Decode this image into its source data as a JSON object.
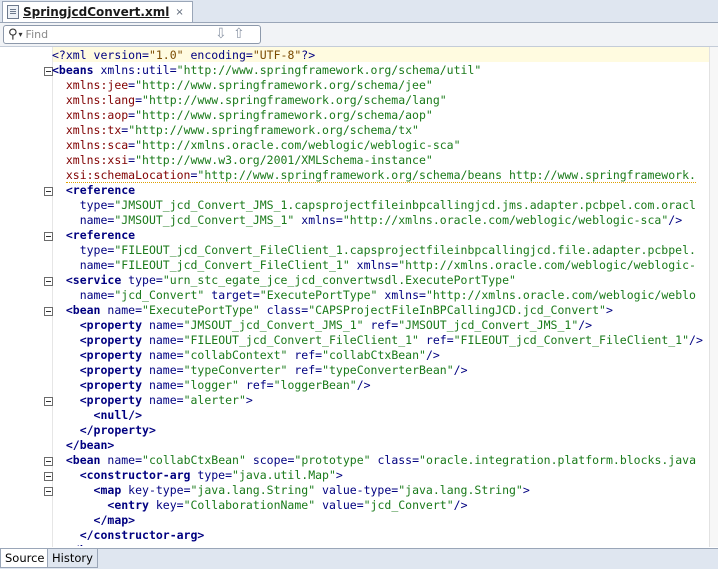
{
  "tab": {
    "title": "SpringjcdConvert.xml",
    "close": "×"
  },
  "find": {
    "placeholder": "Find"
  },
  "lines": [
    [
      [
        "pi",
        "<?xml "
      ],
      [
        "attr",
        "version"
      ],
      [
        "punc",
        "="
      ],
      [
        "pival",
        "\"1.0\""
      ],
      [
        "attr",
        " encoding"
      ],
      [
        "punc",
        "="
      ],
      [
        "pival",
        "\"UTF-8\""
      ],
      [
        "pi",
        "?>"
      ]
    ],
    [
      [
        "tag",
        "<beans"
      ],
      [
        "attr",
        " xmlns:util"
      ],
      [
        "punc",
        "="
      ],
      [
        "val",
        "\"http://www.springframework.org/schema/util\""
      ]
    ],
    [
      [
        "plain",
        "  "
      ],
      [
        "ns",
        "xmlns:jee"
      ],
      [
        "punc",
        "="
      ],
      [
        "val",
        "\"http://www.springframework.org/schema/jee\""
      ]
    ],
    [
      [
        "plain",
        "  "
      ],
      [
        "ns",
        "xmlns:lang"
      ],
      [
        "punc",
        "="
      ],
      [
        "val",
        "\"http://www.springframework.org/schema/lang\""
      ]
    ],
    [
      [
        "plain",
        "  "
      ],
      [
        "ns",
        "xmlns:aop"
      ],
      [
        "punc",
        "="
      ],
      [
        "val",
        "\"http://www.springframework.org/schema/aop\""
      ]
    ],
    [
      [
        "plain",
        "  "
      ],
      [
        "ns",
        "xmlns:tx"
      ],
      [
        "punc",
        "="
      ],
      [
        "val",
        "\"http://www.springframework.org/schema/tx\""
      ]
    ],
    [
      [
        "plain",
        "  "
      ],
      [
        "ns",
        "xmlns:sca"
      ],
      [
        "punc",
        "="
      ],
      [
        "val",
        "\"http://xmlns.oracle.com/weblogic/weblogic-sca\""
      ]
    ],
    [
      [
        "plain",
        "  "
      ],
      [
        "ns",
        "xmlns:xsi"
      ],
      [
        "punc",
        "="
      ],
      [
        "val",
        "\"http://www.w3.org/2001/XMLSchema-instance\""
      ]
    ],
    [
      [
        "plain",
        "  "
      ],
      [
        "ns",
        "xsi:schemaLocation"
      ],
      [
        "punc",
        "="
      ],
      [
        "val",
        "\"http://www.springframework.org/schema/beans http://www.springframework."
      ]
    ],
    [
      [
        "plain",
        "  "
      ],
      [
        "tag",
        "<reference"
      ]
    ],
    [
      [
        "plain",
        "    "
      ],
      [
        "attr",
        "type"
      ],
      [
        "punc",
        "="
      ],
      [
        "val",
        "\"JMSOUT_jcd_Convert_JMS_1.capsprojectfileinbpcallingjcd.jms.adapter.pcbpel.com.oracl"
      ]
    ],
    [
      [
        "plain",
        "    "
      ],
      [
        "attr",
        "name"
      ],
      [
        "punc",
        "="
      ],
      [
        "val",
        "\"JMSOUT_jcd_Convert_JMS_1\""
      ],
      [
        "attr",
        " xmlns"
      ],
      [
        "punc",
        "="
      ],
      [
        "val",
        "\"http://xmlns.oracle.com/weblogic/weblogic-sca\""
      ],
      [
        "punc",
        "/>"
      ]
    ],
    [
      [
        "plain",
        "  "
      ],
      [
        "tag",
        "<reference"
      ]
    ],
    [
      [
        "plain",
        "    "
      ],
      [
        "attr",
        "type"
      ],
      [
        "punc",
        "="
      ],
      [
        "val",
        "\"FILEOUT_jcd_Convert_FileClient_1.capsprojectfileinbpcallingjcd.file.adapter.pcbpel."
      ]
    ],
    [
      [
        "plain",
        "    "
      ],
      [
        "attr",
        "name"
      ],
      [
        "punc",
        "="
      ],
      [
        "val",
        "\"FILEOUT_jcd_Convert_FileClient_1\""
      ],
      [
        "attr",
        " xmlns"
      ],
      [
        "punc",
        "="
      ],
      [
        "val",
        "\"http://xmlns.oracle.com/weblogic/weblogic-"
      ]
    ],
    [
      [
        "plain",
        "  "
      ],
      [
        "tag",
        "<service"
      ],
      [
        "attr",
        " type"
      ],
      [
        "punc",
        "="
      ],
      [
        "val",
        "\"urn_stc_egate_jce_jcd_convertwsdl.ExecutePortType\""
      ]
    ],
    [
      [
        "plain",
        "    "
      ],
      [
        "attr",
        "name"
      ],
      [
        "punc",
        "="
      ],
      [
        "val",
        "\"jcd_Convert\""
      ],
      [
        "attr",
        " target"
      ],
      [
        "punc",
        "="
      ],
      [
        "val",
        "\"ExecutePortType\""
      ],
      [
        "attr",
        " xmlns"
      ],
      [
        "punc",
        "="
      ],
      [
        "val",
        "\"http://xmlns.oracle.com/weblogic/weblo"
      ]
    ],
    [
      [
        "plain",
        "  "
      ],
      [
        "tag",
        "<bean"
      ],
      [
        "attr",
        " name"
      ],
      [
        "punc",
        "="
      ],
      [
        "val",
        "\"ExecutePortType\""
      ],
      [
        "attr",
        " class"
      ],
      [
        "punc",
        "="
      ],
      [
        "val",
        "\"CAPSProjectFileInBPCallingJCD.jcd_Convert\""
      ],
      [
        "punc",
        ">"
      ]
    ],
    [
      [
        "plain",
        "    "
      ],
      [
        "tag",
        "<property"
      ],
      [
        "attr",
        " name"
      ],
      [
        "punc",
        "="
      ],
      [
        "val",
        "\"JMSOUT_jcd_Convert_JMS_1\""
      ],
      [
        "attr",
        " ref"
      ],
      [
        "punc",
        "="
      ],
      [
        "val",
        "\"JMSOUT_jcd_Convert_JMS_1\""
      ],
      [
        "punc",
        "/>"
      ]
    ],
    [
      [
        "plain",
        "    "
      ],
      [
        "tag",
        "<property"
      ],
      [
        "attr",
        " name"
      ],
      [
        "punc",
        "="
      ],
      [
        "val",
        "\"FILEOUT_jcd_Convert_FileClient_1\""
      ],
      [
        "attr",
        " ref"
      ],
      [
        "punc",
        "="
      ],
      [
        "val",
        "\"FILEOUT_jcd_Convert_FileClient_1\""
      ],
      [
        "punc",
        "/>"
      ]
    ],
    [
      [
        "plain",
        "    "
      ],
      [
        "tag",
        "<property"
      ],
      [
        "attr",
        " name"
      ],
      [
        "punc",
        "="
      ],
      [
        "val",
        "\"collabContext\""
      ],
      [
        "attr",
        " ref"
      ],
      [
        "punc",
        "="
      ],
      [
        "val",
        "\"collabCtxBean\""
      ],
      [
        "punc",
        "/>"
      ]
    ],
    [
      [
        "plain",
        "    "
      ],
      [
        "tag",
        "<property"
      ],
      [
        "attr",
        " name"
      ],
      [
        "punc",
        "="
      ],
      [
        "val",
        "\"typeConverter\""
      ],
      [
        "attr",
        " ref"
      ],
      [
        "punc",
        "="
      ],
      [
        "val",
        "\"typeConverterBean\""
      ],
      [
        "punc",
        "/>"
      ]
    ],
    [
      [
        "plain",
        "    "
      ],
      [
        "tag",
        "<property"
      ],
      [
        "attr",
        " name"
      ],
      [
        "punc",
        "="
      ],
      [
        "val",
        "\"logger\""
      ],
      [
        "attr",
        " ref"
      ],
      [
        "punc",
        "="
      ],
      [
        "val",
        "\"loggerBean\""
      ],
      [
        "punc",
        "/>"
      ]
    ],
    [
      [
        "plain",
        "    "
      ],
      [
        "tag",
        "<property"
      ],
      [
        "attr",
        " name"
      ],
      [
        "punc",
        "="
      ],
      [
        "val",
        "\"alerter\""
      ],
      [
        "punc",
        ">"
      ]
    ],
    [
      [
        "plain",
        "      "
      ],
      [
        "tag",
        "<null/>"
      ]
    ],
    [
      [
        "plain",
        "    "
      ],
      [
        "tag",
        "</property>"
      ]
    ],
    [
      [
        "plain",
        "  "
      ],
      [
        "tag",
        "</bean>"
      ]
    ],
    [
      [
        "plain",
        "  "
      ],
      [
        "tag",
        "<bean"
      ],
      [
        "attr",
        " name"
      ],
      [
        "punc",
        "="
      ],
      [
        "val",
        "\"collabCtxBean\""
      ],
      [
        "attr",
        " scope"
      ],
      [
        "punc",
        "="
      ],
      [
        "val",
        "\"prototype\""
      ],
      [
        "attr",
        " class"
      ],
      [
        "punc",
        "="
      ],
      [
        "val",
        "\"oracle.integration.platform.blocks.java"
      ]
    ],
    [
      [
        "plain",
        "    "
      ],
      [
        "tag",
        "<constructor-arg"
      ],
      [
        "attr",
        " type"
      ],
      [
        "punc",
        "="
      ],
      [
        "val",
        "\"java.util.Map\""
      ],
      [
        "punc",
        ">"
      ]
    ],
    [
      [
        "plain",
        "      "
      ],
      [
        "tag",
        "<map"
      ],
      [
        "attr",
        " key-type"
      ],
      [
        "punc",
        "="
      ],
      [
        "val",
        "\"java.lang.String\""
      ],
      [
        "attr",
        " value-type"
      ],
      [
        "punc",
        "="
      ],
      [
        "val",
        "\"java.lang.String\""
      ],
      [
        "punc",
        ">"
      ]
    ],
    [
      [
        "plain",
        "        "
      ],
      [
        "tag",
        "<entry"
      ],
      [
        "attr",
        " key"
      ],
      [
        "punc",
        "="
      ],
      [
        "val",
        "\"CollaborationName\""
      ],
      [
        "attr",
        " value"
      ],
      [
        "punc",
        "="
      ],
      [
        "val",
        "\"jcd_Convert\""
      ],
      [
        "punc",
        "/>"
      ]
    ],
    [
      [
        "plain",
        "      "
      ],
      [
        "tag",
        "</map>"
      ]
    ],
    [
      [
        "plain",
        "    "
      ],
      [
        "tag",
        "</constructor-arg>"
      ]
    ],
    [
      [
        "plain",
        "  "
      ],
      [
        "tag",
        "</bean>"
      ]
    ]
  ],
  "folds": [
    1,
    9,
    12,
    15,
    17,
    23,
    27,
    28,
    29
  ],
  "bottom_tabs": [
    {
      "label": "Source",
      "active": true
    },
    {
      "label": "History",
      "active": false
    }
  ]
}
